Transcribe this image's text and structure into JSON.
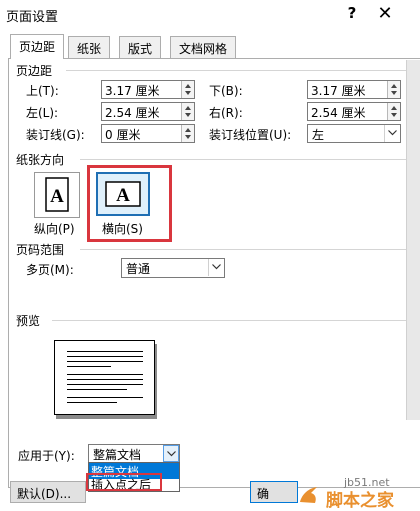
{
  "window": {
    "title": "页面设置",
    "help": "?",
    "close": "✕"
  },
  "tabs": [
    {
      "label": "页边距",
      "active": true
    },
    {
      "label": "纸张"
    },
    {
      "label": "版式"
    },
    {
      "label": "文档网格"
    }
  ],
  "margins": {
    "group_label": "页边距",
    "top_label": "上(T):",
    "top_value": "3.17 厘米",
    "bottom_label": "下(B):",
    "bottom_value": "3.17 厘米",
    "left_label": "左(L):",
    "left_value": "2.54 厘米",
    "right_label": "右(R):",
    "right_value": "2.54 厘米",
    "gutter_label": "装订线(G):",
    "gutter_value": "0 厘米",
    "gutter_pos_label": "装订线位置(U):",
    "gutter_pos_value": "左"
  },
  "orientation": {
    "group_label": "纸张方向",
    "portrait_label": "纵向(P)",
    "landscape_label": "横向(S)",
    "icon_letter": "A"
  },
  "pages": {
    "group_label": "页码范围",
    "multi_label": "多页(M):",
    "multi_value": "普通"
  },
  "preview": {
    "group_label": "预览"
  },
  "apply": {
    "label": "应用于(Y):",
    "value": "整篇文档",
    "options": [
      "整篇文档",
      "插入点之后"
    ]
  },
  "buttons": {
    "default_label": "默认(D)...",
    "ok_partial": "确"
  },
  "watermark": {
    "site": "jb51.net",
    "brand": "脚本之家"
  },
  "colors": {
    "highlight": "#d9363e",
    "selection": "#0078d7",
    "watermark_brand": "#e9902f"
  }
}
